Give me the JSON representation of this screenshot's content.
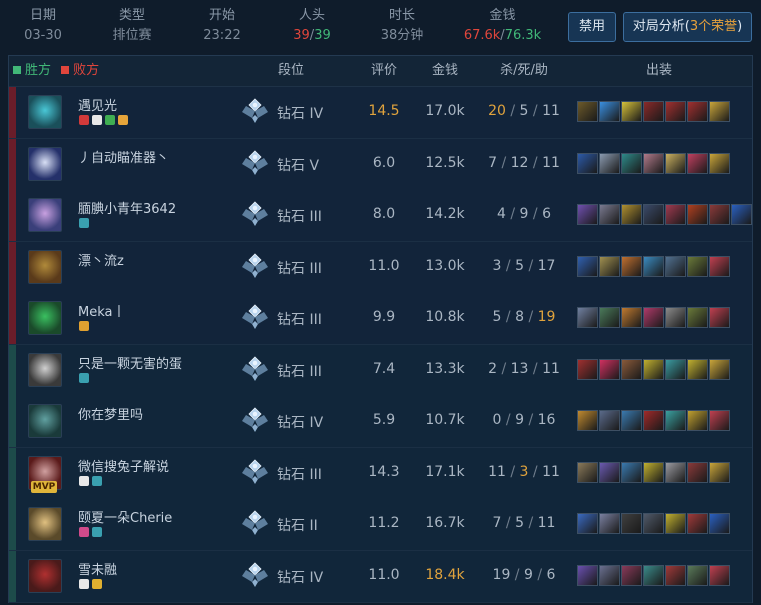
{
  "summary": {
    "date": {
      "label": "日期",
      "value": "03-30"
    },
    "type": {
      "label": "类型",
      "value": "排位赛"
    },
    "start": {
      "label": "开始",
      "value": "23:22"
    },
    "kills": {
      "label": "人头",
      "red": "39",
      "green": "39"
    },
    "duration": {
      "label": "时长",
      "value": "38分钟"
    },
    "gold": {
      "label": "金钱",
      "red": "67.6k",
      "green": "76.3k"
    }
  },
  "buttons": {
    "ban": "禁用",
    "analysis_prefix": "对局分析(",
    "analysis_accent": "3个荣誉",
    "analysis_suffix": ")"
  },
  "header": {
    "win": "胜方",
    "lose": "败方",
    "rank": "段位",
    "score": "评价",
    "gold": "金钱",
    "kda": "杀/死/助",
    "items": "出装"
  },
  "colors": {
    "win": "#41b878",
    "lose": "#e0463c",
    "highlight": "#e0a33d"
  },
  "players": [
    {
      "name": "遇见光",
      "team": "lose",
      "rank": "钻石 IV",
      "score": "14.5",
      "score_hl": true,
      "gold": "17.0k",
      "gold_hl": false,
      "k": "20",
      "d": "5",
      "a": "11",
      "k_hl": true,
      "a_hl": false,
      "mvp": false,
      "avatar": [
        "#1a4f5a",
        "#49c7d6"
      ],
      "badges": [
        "#d23a3a",
        "#e8e8e8",
        "#3fae52",
        "#e6a53a"
      ],
      "items": [
        "#6d5a2a",
        "#3a8fe0",
        "#d6c23a",
        "#8a2a2a",
        "#a23030",
        "#a23030",
        "#c9a53a"
      ]
    },
    {
      "name": "丿自动瞄准器丶",
      "team": "lose",
      "rank": "钻石 V",
      "score": "6.0",
      "score_hl": false,
      "gold": "12.5k",
      "gold_hl": false,
      "k": "7",
      "d": "12",
      "a": "11",
      "k_hl": false,
      "a_hl": false,
      "mvp": false,
      "avatar": [
        "#24306a",
        "#d8dff5"
      ],
      "badges": [],
      "items": [
        "#2c5aa8",
        "#8a9ab0",
        "#2e8a8a",
        "#b07a8a",
        "#c9b060",
        "#c04060",
        "#c9a53a"
      ]
    },
    {
      "name": "腼腆小青年3642",
      "team": "lose",
      "rank": "钻石 III",
      "score": "8.0",
      "score_hl": false,
      "gold": "14.2k",
      "gold_hl": false,
      "k": "4",
      "d": "9",
      "a": "6",
      "k_hl": false,
      "a_hl": false,
      "mvp": false,
      "avatar": [
        "#3a3f7a",
        "#c8a0e0"
      ],
      "badges": [
        "#3aa0b0"
      ],
      "items": [
        "#7050b0",
        "#7a7a90",
        "#b09030",
        "#3a4a6a",
        "#a03a50",
        "#b04020",
        "#8a3a3a",
        "#2a60c0"
      ]
    },
    {
      "name": "漂丶流z",
      "team": "lose",
      "rank": "钻石 III",
      "score": "11.0",
      "score_hl": false,
      "gold": "13.0k",
      "gold_hl": false,
      "k": "3",
      "d": "5",
      "a": "17",
      "k_hl": false,
      "a_hl": false,
      "mvp": false,
      "avatar": [
        "#5a3a1a",
        "#b08a3a"
      ],
      "badges": [],
      "items": [
        "#3060b0",
        "#a09050",
        "#c07030",
        "#3a8ac0",
        "#507090",
        "#6a7a3a",
        "#c04050"
      ]
    },
    {
      "name": "Meka丨",
      "team": "lose",
      "rank": "钻石 III",
      "score": "9.9",
      "score_hl": false,
      "gold": "10.8k",
      "gold_hl": false,
      "k": "5",
      "d": "8",
      "a": "19",
      "k_hl": false,
      "a_hl": true,
      "mvp": false,
      "avatar": [
        "#1a4a2a",
        "#3ac060"
      ],
      "badges": [
        "#e0a030"
      ],
      "items": [
        "#7080a0",
        "#4a7a5a",
        "#c07a30",
        "#b03a6a",
        "#8a8a8a",
        "#6a7a3a",
        "#c04050"
      ]
    },
    {
      "name": "只是一颗无害的蛋",
      "team": "win",
      "rank": "钻石 III",
      "score": "7.4",
      "score_hl": false,
      "gold": "13.3k",
      "gold_hl": false,
      "k": "2",
      "d": "13",
      "a": "11",
      "k_hl": false,
      "a_hl": false,
      "mvp": false,
      "avatar": [
        "#3a3a3a",
        "#d0d0d0"
      ],
      "badges": [
        "#3aa0b0"
      ],
      "items": [
        "#a03030",
        "#d03060",
        "#8a5a3a",
        "#c0b030",
        "#3a9aa0",
        "#c0b030",
        "#c9a53a"
      ]
    },
    {
      "name": "你在梦里吗",
      "team": "win",
      "rank": "钻石 IV",
      "score": "5.9",
      "score_hl": false,
      "gold": "10.7k",
      "gold_hl": false,
      "k": "0",
      "d": "9",
      "a": "16",
      "k_hl": false,
      "a_hl": false,
      "mvp": false,
      "avatar": [
        "#1a3a3a",
        "#60a0a0"
      ],
      "badges": [],
      "items": [
        "#c08a30",
        "#5a6a8a",
        "#3a7ab0",
        "#a02a2a",
        "#3aa0a0",
        "#c0a030",
        "#c04050"
      ]
    },
    {
      "name": "微信搜兔子解说",
      "team": "win",
      "rank": "钻石 III",
      "score": "14.3",
      "score_hl": false,
      "gold": "17.1k",
      "gold_hl": false,
      "k": "11",
      "d": "3",
      "a": "11",
      "k_hl": false,
      "d_hl": true,
      "a_hl": false,
      "mvp": true,
      "avatar": [
        "#5a1a1a",
        "#d0a0a0"
      ],
      "badges": [
        "#e8e8e8",
        "#3aa0b0"
      ],
      "items": [
        "#8a7a5a",
        "#6a5ab0",
        "#3a7ab0",
        "#c0b030",
        "#9a9aa0",
        "#8a3a3a",
        "#c9a53a"
      ]
    },
    {
      "name": "颐夏一朵Cherie",
      "team": "win",
      "rank": "钻石 II",
      "score": "11.2",
      "score_hl": false,
      "gold": "16.7k",
      "gold_hl": false,
      "k": "7",
      "d": "5",
      "a": "11",
      "k_hl": false,
      "a_hl": false,
      "mvp": false,
      "avatar": [
        "#5a4a2a",
        "#e0c080"
      ],
      "badges": [
        "#d04a8a",
        "#3aa0b0"
      ],
      "items": [
        "#3a6ac0",
        "#7a80a0",
        "#404040",
        "#505a6a",
        "#c0b030",
        "#a03a3a",
        "#2a60c0"
      ]
    },
    {
      "name": "雪未融",
      "team": "win",
      "rank": "钻石 IV",
      "score": "11.0",
      "score_hl": false,
      "gold": "18.4k",
      "gold_hl": true,
      "k": "19",
      "d": "9",
      "a": "6",
      "k_hl": false,
      "a_hl": false,
      "mvp": false,
      "avatar": [
        "#4a1a1a",
        "#b03030"
      ],
      "badges": [
        "#e8e8e8",
        "#e0b030"
      ],
      "items": [
        "#6a50b0",
        "#6a7090",
        "#8a3a5a",
        "#3a8a8a",
        "#a03a3a",
        "#5a7a5a",
        "#c04050"
      ]
    }
  ]
}
